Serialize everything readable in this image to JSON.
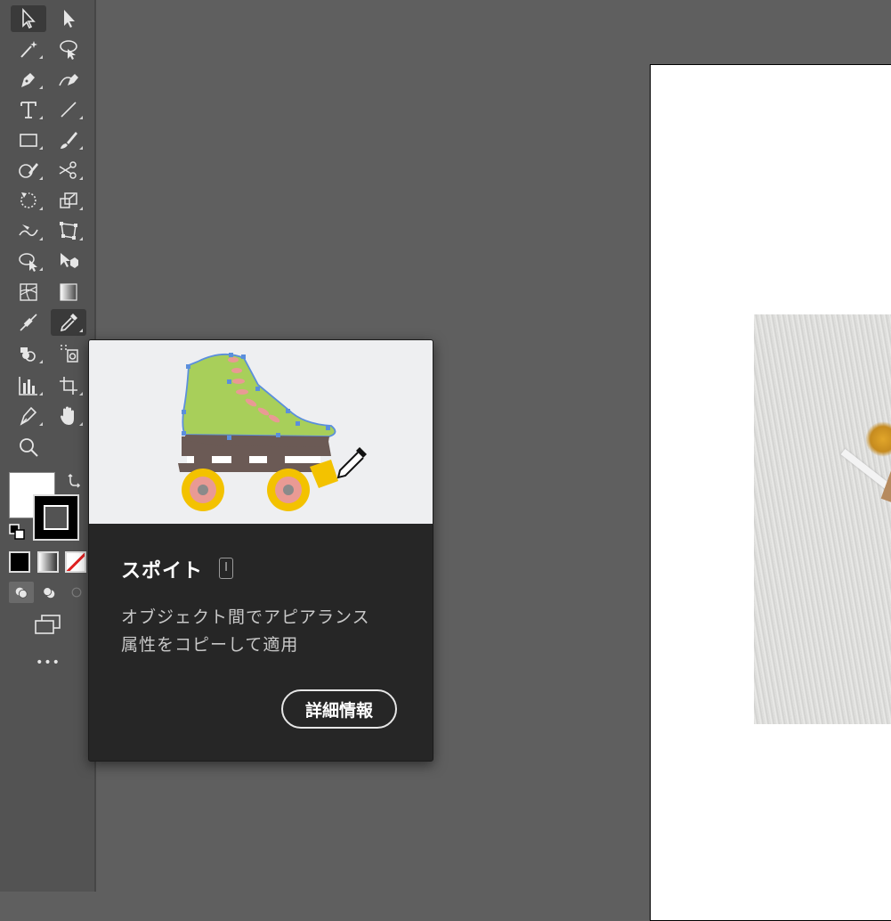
{
  "toolbar": {
    "tools": [
      {
        "name": "selection-tool-icon",
        "selected": true
      },
      {
        "name": "direct-selection-tool-icon"
      },
      {
        "name": "magic-wand-tool-icon"
      },
      {
        "name": "lasso-tool-icon"
      },
      {
        "name": "pen-tool-icon"
      },
      {
        "name": "curvature-tool-icon"
      },
      {
        "name": "type-tool-icon",
        "glyph": "T"
      },
      {
        "name": "line-segment-tool-icon"
      },
      {
        "name": "rectangle-tool-icon"
      },
      {
        "name": "paintbrush-tool-icon"
      },
      {
        "name": "shaper-tool-icon"
      },
      {
        "name": "scissors-tool-icon"
      },
      {
        "name": "rotate-tool-icon"
      },
      {
        "name": "scale-tool-icon"
      },
      {
        "name": "warp-tool-icon"
      },
      {
        "name": "free-transform-tool-icon"
      },
      {
        "name": "shape-builder-tool-icon"
      },
      {
        "name": "perspective-grid-tool-icon"
      },
      {
        "name": "mesh-tool-icon"
      },
      {
        "name": "gradient-tool-icon"
      },
      {
        "name": "blend-tool-icon"
      },
      {
        "name": "eyedropper-tool-icon",
        "selected": true
      },
      {
        "name": "symbol-sprayer-tool-icon"
      },
      {
        "name": "artboard-tool-icon"
      },
      {
        "name": "column-graph-tool-icon"
      },
      {
        "name": "crop-tool-icon"
      },
      {
        "name": "paint-tool-icon"
      },
      {
        "name": "hand-tool-icon"
      },
      {
        "name": "zoom-tool-icon"
      }
    ],
    "fill_color": "#ffffff",
    "stroke_color": "#000000",
    "more_label": "•••"
  },
  "tooltip": {
    "title": "スポイト",
    "shortcut": "I",
    "description_line1": "オブジェクト間でアピアランス",
    "description_line2": "属性をコピーして適用",
    "button_label": "詳細情報"
  },
  "colors": {
    "toolbar_bg": "#535353",
    "canvas_bg": "#5f5f5f",
    "tooltip_bg": "#262626",
    "skate_green": "#a8cf5a",
    "skate_lace": "#e99a94",
    "skate_wheel": "#f3c200",
    "skate_base": "#6b5a55"
  }
}
